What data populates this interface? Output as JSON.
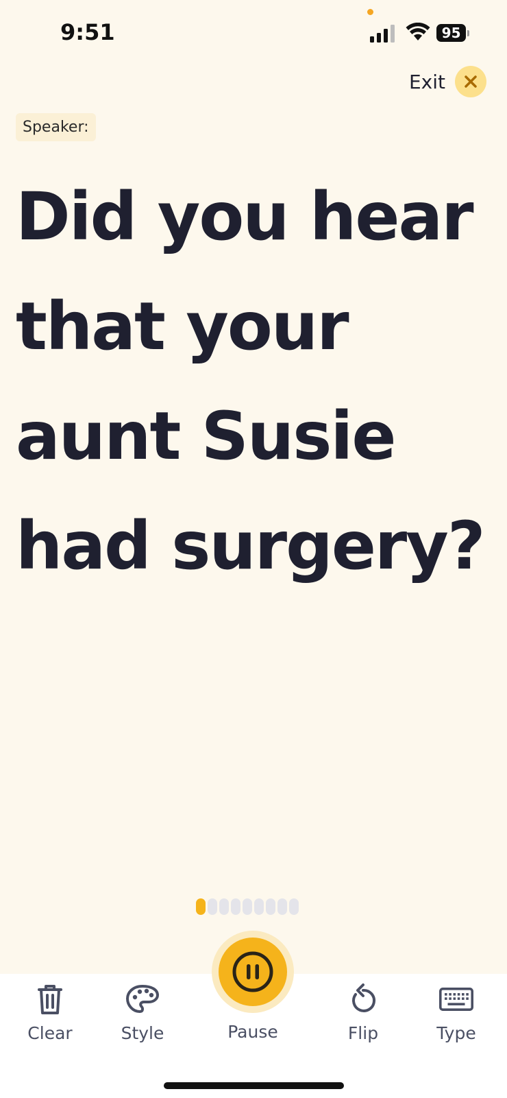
{
  "status_bar": {
    "time": "9:51",
    "battery": "95"
  },
  "header": {
    "exit_label": "Exit"
  },
  "speaker": {
    "label": "Speaker:"
  },
  "content": {
    "message": "Did you hear that your aunt Susie had surgery?"
  },
  "pager": {
    "total": 9,
    "active_index": 0
  },
  "toolbar": {
    "clear_label": "Clear",
    "style_label": "Style",
    "pause_label": "Pause",
    "flip_label": "Flip",
    "type_label": "Type"
  },
  "colors": {
    "background": "#FDF8ED",
    "accent": "#F5B31B",
    "accent_light": "#FCE08C",
    "text": "#1F2030",
    "icon": "#4A4F63"
  },
  "icons": {
    "clear": "trash-icon",
    "style": "palette-icon",
    "pause": "pause-icon",
    "flip": "rotate-ccw-icon",
    "type": "keyboard-icon",
    "exit": "close-icon"
  }
}
